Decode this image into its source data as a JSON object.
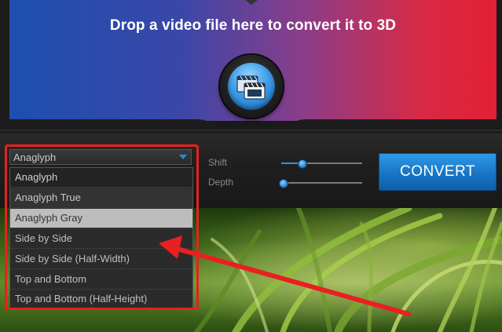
{
  "drop_zone": {
    "instruction": "Drop a video file here to convert it to 3D",
    "open_icon": "clapperboard-folder-icon"
  },
  "controls": {
    "shift_label": "Shift",
    "depth_label": "Depth",
    "shift_value": 0.25,
    "depth_value": 0.0,
    "convert_label": "CONVERT"
  },
  "mode_select": {
    "selected": "Anaglyph",
    "options": [
      "Anaglyph",
      "Anaglyph True",
      "Anaglyph Gray",
      "Side by Side",
      "Side by Side (Half-Width)",
      "Top and Bottom",
      "Top and Bottom (Half-Height)"
    ],
    "highlighted": "Anaglyph Gray"
  },
  "colors": {
    "accent_blue": "#1a78c8",
    "annotation_red": "#e8201f"
  }
}
